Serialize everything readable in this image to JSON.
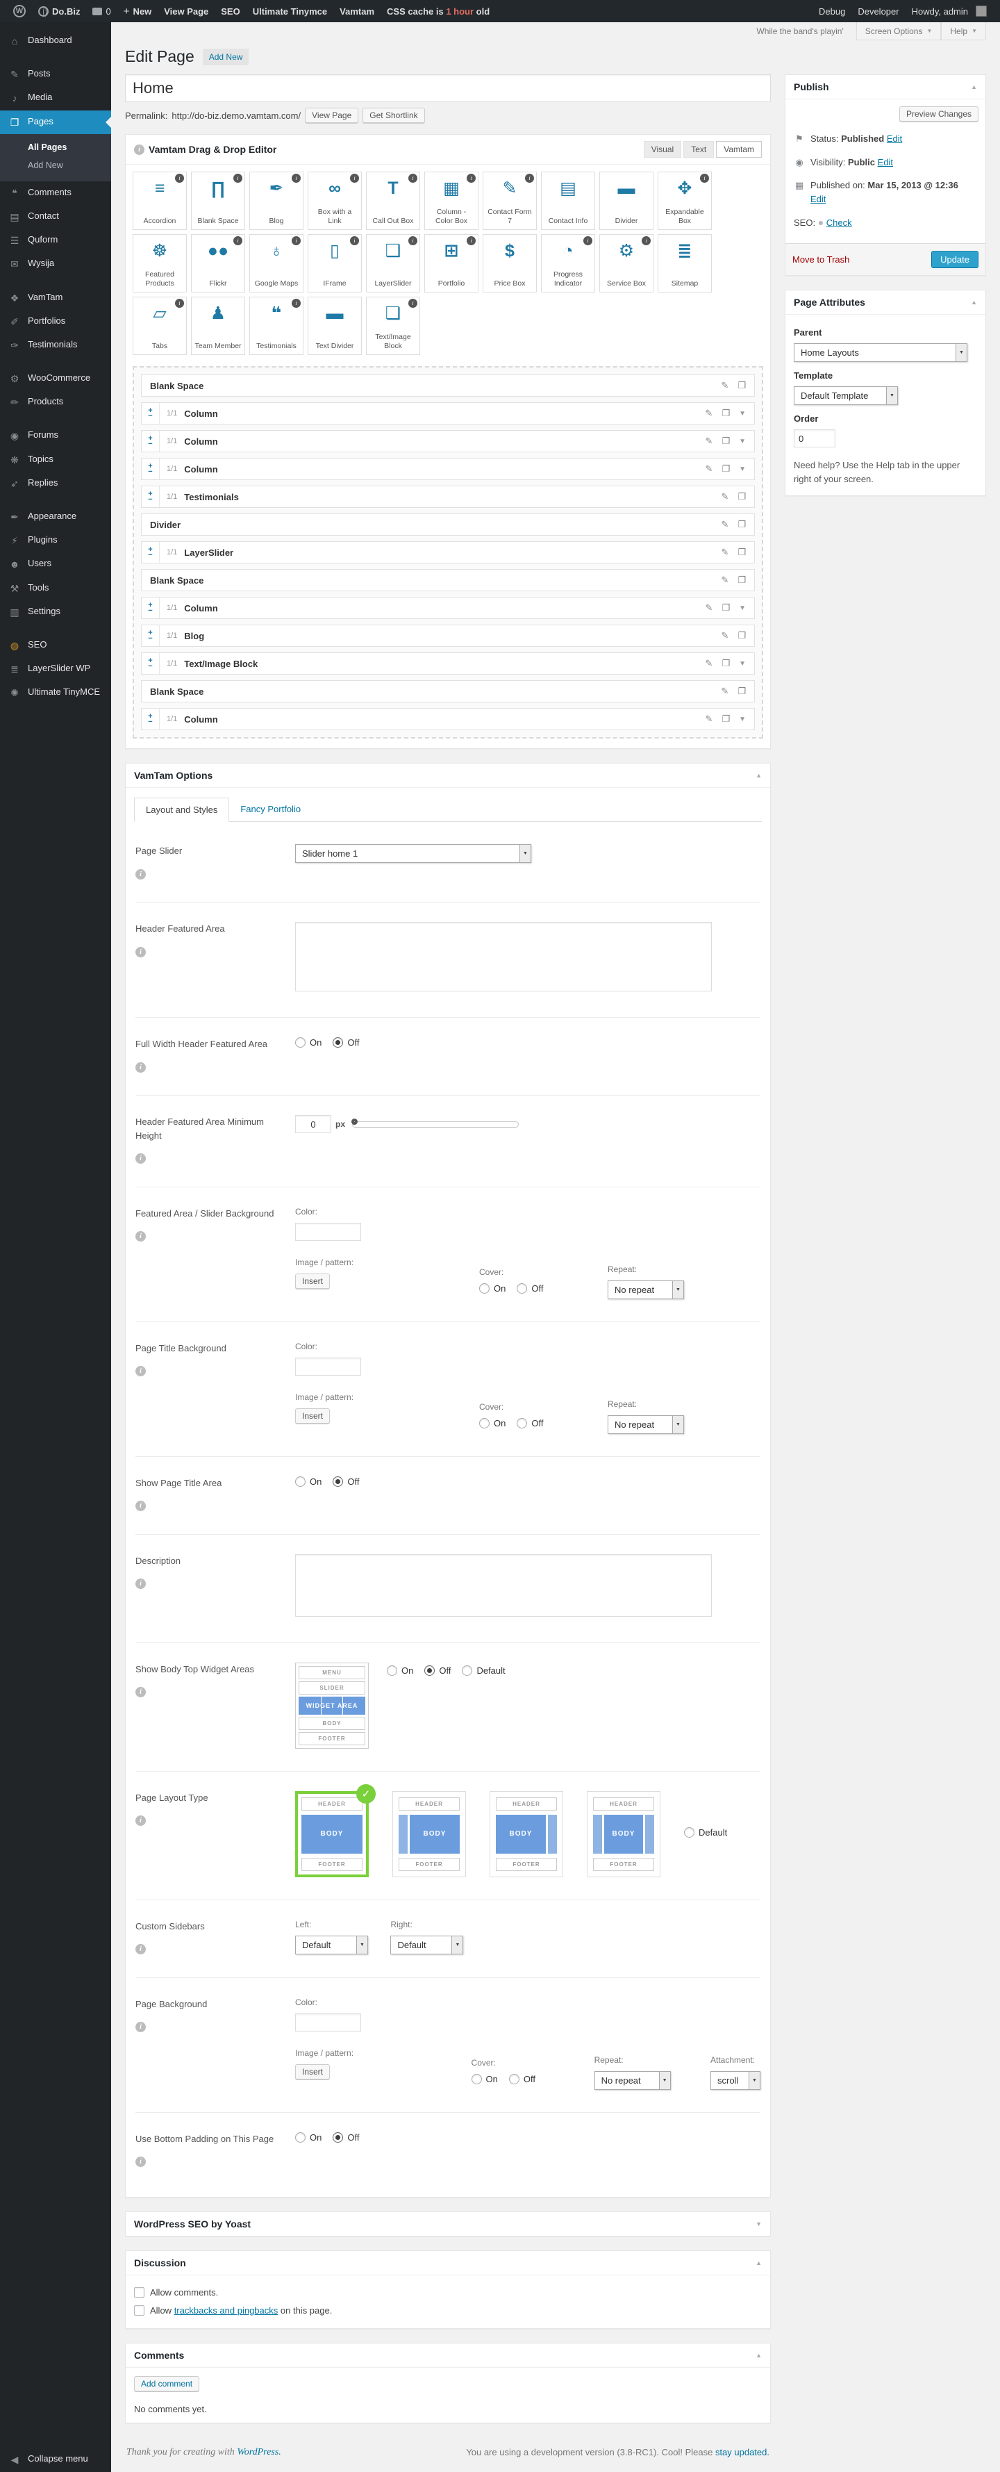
{
  "colors": {
    "menu_active_blue": "#1e8cbe",
    "link_blue": "#0074a2",
    "button_blue": "#2ea2cc",
    "shelf_icon_teal": "#1f7aa5",
    "layout_blue": "#6b9dde",
    "selected_green": "#7ad03a",
    "trash_red": "#a00000",
    "cache_warning_red": "#e36d60",
    "seo_icon_orange": "#ca8f24"
  },
  "admin_bar": {
    "site_name": "Do.Biz",
    "comment_count": "0",
    "new_label": "New",
    "links": [
      "View Page",
      "SEO",
      "Ultimate Tinymce",
      "Vamtam"
    ],
    "cache_prefix": "CSS cache is ",
    "cache_highlight": "1 hour",
    "cache_suffix": " old",
    "debug": "Debug",
    "developer": "Developer",
    "howdy": "Howdy, admin"
  },
  "screen_meta": {
    "quote": "While the band's playin'",
    "screen_options": "Screen Options",
    "help": "Help"
  },
  "sidebar": {
    "items": [
      {
        "label": "Dashboard",
        "icon": "⌂",
        "key": "dashboard"
      },
      {
        "gap": true
      },
      {
        "label": "Posts",
        "icon": "✎",
        "key": "posts"
      },
      {
        "label": "Media",
        "icon": "♪",
        "key": "media"
      },
      {
        "label": "Pages",
        "icon": "❐",
        "key": "pages",
        "active": true,
        "submenu": [
          {
            "label": "All Pages",
            "current": true
          },
          {
            "label": "Add New",
            "current": false
          }
        ]
      },
      {
        "label": "Comments",
        "icon": "❝",
        "key": "comments"
      },
      {
        "label": "Contact",
        "icon": "▤",
        "key": "contact"
      },
      {
        "label": "Quform",
        "icon": "☰",
        "key": "quform"
      },
      {
        "label": "Wysija",
        "icon": "✉",
        "key": "wysija"
      },
      {
        "gap": true
      },
      {
        "label": "VamTam",
        "icon": "❖",
        "key": "vamtam"
      },
      {
        "label": "Portfolios",
        "icon": "✐",
        "key": "portfolios"
      },
      {
        "label": "Testimonials",
        "icon": "✑",
        "key": "testimonials"
      },
      {
        "gap": true
      },
      {
        "label": "WooCommerce",
        "icon": "⚙",
        "key": "woocommerce"
      },
      {
        "label": "Products",
        "icon": "✏",
        "key": "products"
      },
      {
        "gap": true
      },
      {
        "label": "Forums",
        "icon": "◉",
        "key": "forums"
      },
      {
        "label": "Topics",
        "icon": "❋",
        "key": "topics"
      },
      {
        "label": "Replies",
        "icon": "➶",
        "key": "replies"
      },
      {
        "gap": true
      },
      {
        "label": "Appearance",
        "icon": "✒",
        "key": "appearance"
      },
      {
        "label": "Plugins",
        "icon": "⚡",
        "key": "plugins"
      },
      {
        "label": "Users",
        "icon": "☻",
        "key": "users"
      },
      {
        "label": "Tools",
        "icon": "⚒",
        "key": "tools"
      },
      {
        "label": "Settings",
        "icon": "▥",
        "key": "settings"
      },
      {
        "gap": true
      },
      {
        "label": "SEO",
        "icon": "◍",
        "key": "seo",
        "icon_color": "#ca8f24"
      },
      {
        "label": "LayerSlider WP",
        "icon": "≣",
        "key": "layerslider-wp"
      },
      {
        "label": "Ultimate TinyMCE",
        "icon": "✺",
        "key": "ultimate-tinymce"
      },
      {
        "gap": true,
        "grow": true
      },
      {
        "label": "Collapse menu",
        "icon": "◀",
        "key": "collapse-menu"
      }
    ]
  },
  "page": {
    "heading": "Edit Page",
    "add_new": "Add New",
    "title_value": "Home",
    "permalink_label": "Permalink:",
    "permalink_url": "http://do-biz.demo.vamtam.com/",
    "view_page": "View Page",
    "get_shortlink": "Get Shortlink"
  },
  "editor": {
    "title": "Vamtam Drag & Drop Editor",
    "tabs": [
      {
        "label": "Visual",
        "active": false
      },
      {
        "label": "Text",
        "active": false
      },
      {
        "label": "Vamtam",
        "active": true
      }
    ],
    "shelf": [
      {
        "label": "Accordion",
        "icon": "≡",
        "info": true
      },
      {
        "label": "Blank Space",
        "icon": "∏",
        "info": true
      },
      {
        "label": "Blog",
        "icon": "✒",
        "info": true
      },
      {
        "label": "Box with a Link",
        "icon": "∞",
        "info": true
      },
      {
        "label": "Call Out Box",
        "icon": "T",
        "info": true
      },
      {
        "label": "Column - Color Box",
        "icon": "▦",
        "info": true
      },
      {
        "label": "Contact Form 7",
        "icon": "✎",
        "info": true
      },
      {
        "label": "Contact Info",
        "icon": "▤",
        "info": false
      },
      {
        "label": "Divider",
        "icon": "▬",
        "info": false
      },
      {
        "label": "Expandable Box",
        "icon": "✥",
        "info": true
      },
      {
        "label": "Featured Products",
        "icon": "☸",
        "info": false
      },
      {
        "label": "Flickr",
        "icon": "●●",
        "info": true
      },
      {
        "label": "Google Maps",
        "icon": "♁",
        "info": true
      },
      {
        "label": "IFrame",
        "icon": "▯",
        "info": true
      },
      {
        "label": "LayerSlider",
        "icon": "❑",
        "info": true
      },
      {
        "label": "Portfolio",
        "icon": "⊞",
        "info": true
      },
      {
        "label": "Price Box",
        "icon": "$",
        "info": false
      },
      {
        "label": "Progress Indicator",
        "icon": "◔",
        "info": true
      },
      {
        "label": "Service Box",
        "icon": "⚙",
        "info": true
      },
      {
        "label": "Sitemap",
        "icon": "≣",
        "info": false
      },
      {
        "label": "Tabs",
        "icon": "▱",
        "info": true
      },
      {
        "label": "Team Member",
        "icon": "♟",
        "info": false
      },
      {
        "label": "Testimonials",
        "icon": "❝",
        "info": true
      },
      {
        "label": "Text Divider",
        "icon": "▬",
        "info": false
      },
      {
        "label": "Text/Image Block",
        "icon": "❏",
        "info": true
      }
    ],
    "rows": [
      {
        "label": "Blank Space",
        "section": true,
        "arrow": false
      },
      {
        "size": "1/1",
        "label": "Column",
        "arrow": true
      },
      {
        "size": "1/1",
        "label": "Column",
        "arrow": true
      },
      {
        "size": "1/1",
        "label": "Column",
        "arrow": true
      },
      {
        "size": "1/1",
        "label": "Testimonials",
        "arrow": false
      },
      {
        "label": "Divider",
        "section": true,
        "arrow": false
      },
      {
        "size": "1/1",
        "label": "LayerSlider",
        "arrow": false
      },
      {
        "label": "Blank Space",
        "section": true,
        "arrow": false
      },
      {
        "size": "1/1",
        "label": "Column",
        "arrow": true
      },
      {
        "size": "1/1",
        "label": "Blog",
        "arrow": false
      },
      {
        "size": "1/1",
        "label": "Text/Image Block",
        "arrow": true
      },
      {
        "label": "Blank Space",
        "section": true,
        "arrow": false
      },
      {
        "size": "1/1",
        "label": "Column",
        "arrow": true
      }
    ]
  },
  "common": {
    "on": "On",
    "off": "Off",
    "default": "Default",
    "color": "Color:",
    "image_pattern": "Image / pattern:",
    "insert": "Insert",
    "cover": "Cover:",
    "repeat": "Repeat:",
    "no_repeat": "No repeat",
    "attachment": "Attachment:",
    "scroll": "scroll",
    "px": "px",
    "left": "Left:",
    "right": "Right:"
  },
  "vamtam": {
    "box_title": "VamTam Options",
    "tab_layout": "Layout and Styles",
    "tab_portfolio": "Fancy Portfolio",
    "page_slider": {
      "label": "Page Slider",
      "value": "Slider home 1"
    },
    "header_featured_area": {
      "label": "Header Featured Area"
    },
    "full_width": {
      "label": "Full Width Header Featured Area",
      "selected": "Off"
    },
    "min_height": {
      "label": "Header Featured Area Minimum Height",
      "value": "0"
    },
    "featured_bg": {
      "label": "Featured Area / Slider Background"
    },
    "page_title_bg": {
      "label": "Page Title Background"
    },
    "show_page_title": {
      "label": "Show Page Title Area",
      "selected": "Off"
    },
    "description": {
      "label": "Description"
    },
    "widget_areas": {
      "label": "Show Body Top Widget Areas",
      "selected": "Off",
      "diagram": {
        "menu": "MENU",
        "slider": "SLIDER",
        "widget": "WIDGET AREA",
        "body": "BODY",
        "footer": "FOOTER"
      }
    },
    "layout": {
      "label": "Page Layout Type",
      "header": "HEADER",
      "body": "BODY",
      "footer": "FOOTER",
      "selected_index": 0
    },
    "custom_sidebars": {
      "label": "Custom Sidebars",
      "left_value": "Default",
      "right_value": "Default"
    },
    "page_bg": {
      "label": "Page Background",
      "attachment_value": "scroll"
    },
    "bottom_padding": {
      "label": "Use Bottom Padding on This Page",
      "selected": "Off"
    }
  },
  "publish": {
    "title": "Publish",
    "preview": "Preview Changes",
    "status_label": "Status:",
    "status_value": "Published",
    "edit": "Edit",
    "visibility_label": "Visibility:",
    "visibility_value": "Public",
    "published_label": "Published on:",
    "published_value": "Mar 15, 2013 @ 12:36",
    "seo_label": "SEO:",
    "seo_check": "Check",
    "trash": "Move to Trash",
    "update": "Update"
  },
  "page_attributes": {
    "title": "Page Attributes",
    "parent_label": "Parent",
    "parent_value": "Home Layouts",
    "template_label": "Template",
    "template_value": "Default Template",
    "order_label": "Order",
    "order_value": "0",
    "help": "Need help? Use the Help tab in the upper right of your screen."
  },
  "seo_box": {
    "title": "WordPress SEO by Yoast"
  },
  "discussion": {
    "title": "Discussion",
    "allow_comments": "Allow comments.",
    "trackbacks_prefix": "Allow ",
    "trackbacks_link": "trackbacks and pingbacks",
    "trackbacks_suffix": " on this page."
  },
  "comments_box": {
    "title": "Comments",
    "add": "Add comment",
    "empty": "No comments yet."
  },
  "footer": {
    "left_prefix": "Thank you for creating with ",
    "left_link": "WordPress.",
    "right_prefix": "You are using a development version (3.8-RC1). Cool! Please ",
    "right_link": "stay updated."
  }
}
